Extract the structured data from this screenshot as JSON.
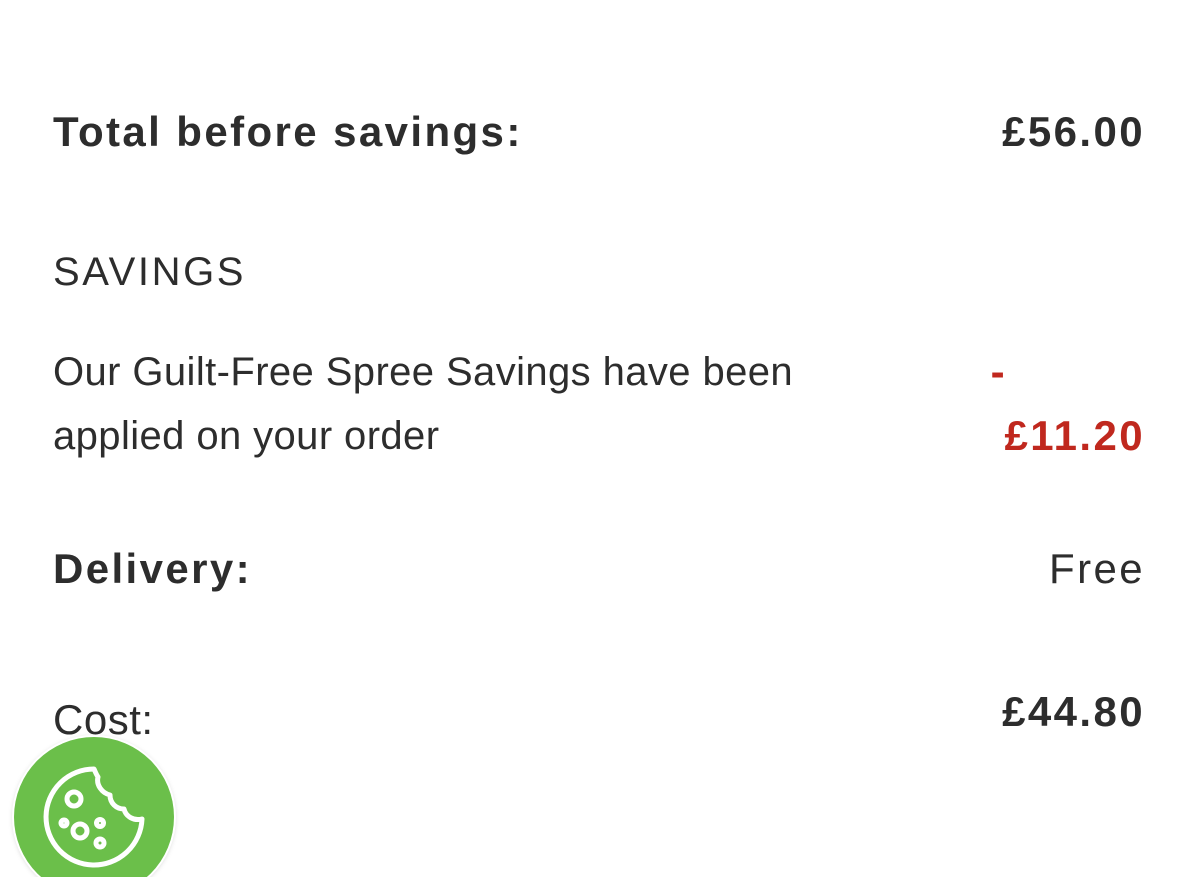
{
  "summary": {
    "total_before_savings": {
      "label": "Total before savings:",
      "value": "£56.00"
    },
    "savings": {
      "heading": "SAVINGS",
      "description": "Our Guilt-Free Spree Savings have been applied on your order",
      "minus_sign": "-",
      "amount": "£11.20",
      "amount_color": "#c0281e"
    },
    "delivery": {
      "label": "Delivery:",
      "value": "Free"
    },
    "cost": {
      "label": "Cost:",
      "value": "£44.80"
    }
  },
  "cookie_button": {
    "icon": "cookie-icon",
    "color": "#6bbf4a"
  }
}
